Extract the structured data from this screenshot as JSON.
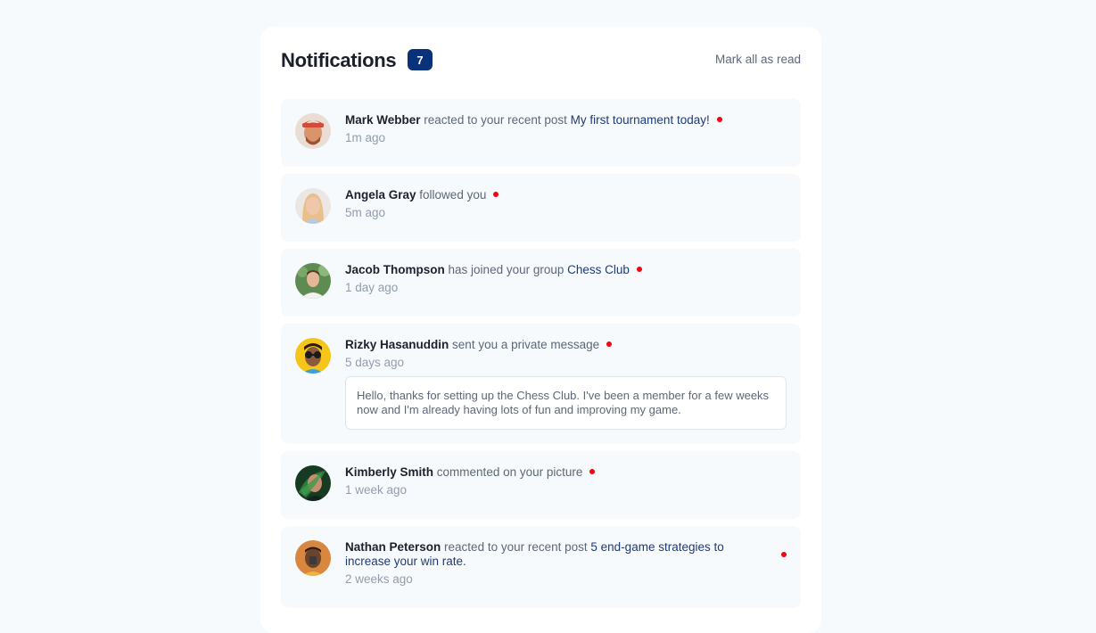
{
  "header": {
    "title": "Notifications",
    "count": "7",
    "mark_all_label": "Mark all as read"
  },
  "colors": {
    "badge": "#0a327b",
    "unread_dot": "#f4050c",
    "card_bg": "#ffffff",
    "item_bg": "#f7fafd"
  },
  "notifications": [
    {
      "name": "Mark Webber",
      "action": "reacted to your recent post",
      "target": "My first tournament today!",
      "time": "1m ago"
    },
    {
      "name": "Angela Gray",
      "action": "followed you",
      "target": "",
      "time": "5m ago"
    },
    {
      "name": "Jacob Thompson",
      "action": "has joined your group",
      "target": "Chess Club",
      "time": "1 day ago"
    },
    {
      "name": "Rizky Hasanuddin",
      "action": "sent you a private message",
      "target": "",
      "time": "5 days ago",
      "message": "Hello, thanks for setting up the Chess Club. I've been a member for a few weeks now and I'm already having lots of fun and improving my game."
    },
    {
      "name": "Kimberly Smith",
      "action": "commented on your picture",
      "target": "",
      "time": "1 week ago"
    },
    {
      "name": "Nathan Peterson",
      "action": "reacted to your recent post",
      "target": "5 end-game strategies to increase your win rate.",
      "time": "2 weeks ago"
    }
  ]
}
